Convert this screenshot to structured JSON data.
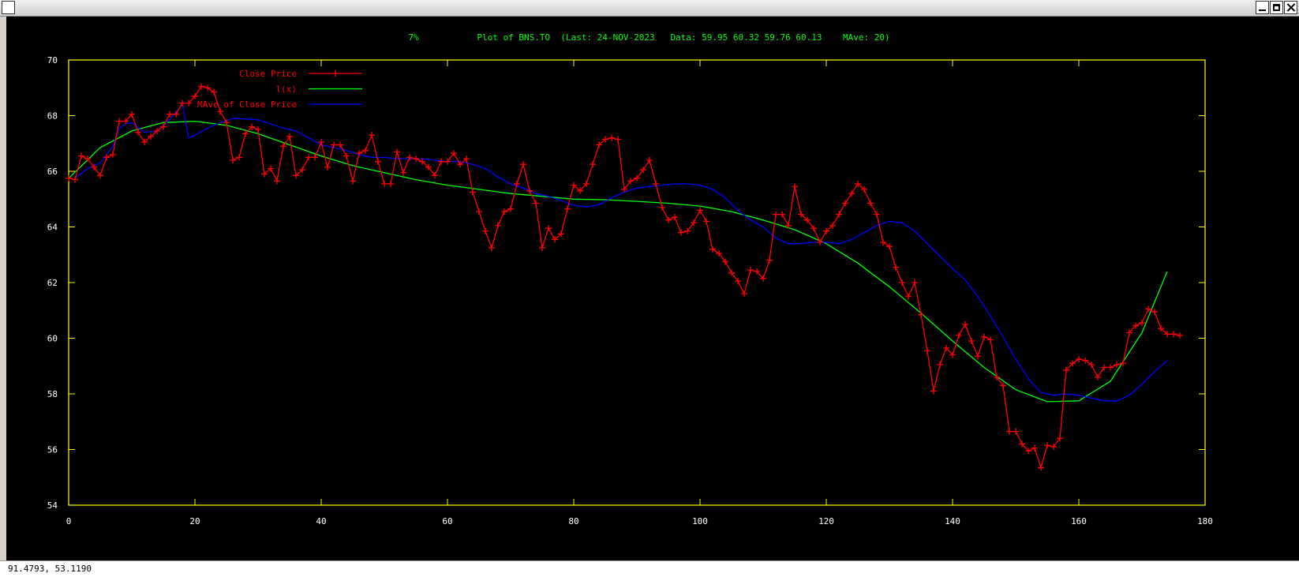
{
  "window": {
    "status_coords": "91.4793,  53.1190"
  },
  "chart_data": {
    "type": "line",
    "title_prefix": "7%",
    "title": "Plot of BNS.TO  (Last: 24-NOV-2023   Data: 59.95 60.32 59.76 60.13    MAve: 20)",
    "xlim": [
      0,
      180
    ],
    "ylim": [
      54,
      70
    ],
    "x_ticks": [
      0,
      20,
      40,
      60,
      80,
      100,
      120,
      140,
      160,
      180
    ],
    "y_ticks": [
      54,
      56,
      58,
      60,
      62,
      64,
      66,
      68,
      70
    ],
    "legend_position": "top-left",
    "colors": {
      "background": "#000000",
      "axes": "#ffff00",
      "title": "#00ff00",
      "close": "#ff0000",
      "fit": "#00ff00",
      "mave": "#0000ff"
    },
    "series": [
      {
        "name": "Close Price",
        "style": "linespoints",
        "values": [
          65.75,
          65.7,
          66.55,
          66.45,
          66.15,
          65.85,
          66.5,
          66.6,
          67.8,
          67.8,
          68.05,
          67.4,
          67.05,
          67.25,
          67.45,
          67.6,
          68.05,
          68.05,
          68.45,
          68.45,
          68.7,
          69.05,
          69.0,
          68.85,
          68.15,
          67.75,
          66.4,
          66.5,
          67.35,
          67.6,
          67.5,
          65.9,
          66.1,
          65.65,
          66.9,
          67.25,
          65.85,
          66.05,
          66.5,
          66.5,
          67.05,
          66.15,
          66.95,
          66.95,
          66.55,
          65.65,
          66.65,
          66.75,
          67.3,
          66.35,
          65.55,
          65.55,
          66.7,
          65.95,
          66.5,
          66.45,
          66.35,
          66.15,
          65.85,
          66.35,
          66.35,
          66.65,
          66.25,
          66.45,
          65.25,
          64.55,
          63.85,
          63.25,
          64.05,
          64.55,
          64.65,
          65.55,
          66.25,
          65.3,
          64.85,
          63.25,
          63.95,
          63.55,
          63.75,
          64.65,
          65.5,
          65.3,
          65.55,
          66.25,
          66.95,
          67.15,
          67.2,
          67.15,
          65.35,
          65.65,
          65.75,
          66.05,
          66.4,
          65.55,
          64.7,
          64.25,
          64.35,
          63.8,
          63.85,
          64.15,
          64.6,
          64.2,
          63.2,
          63.05,
          62.75,
          62.35,
          62.05,
          61.6,
          62.45,
          62.4,
          62.15,
          62.8,
          64.45,
          64.45,
          64.05,
          65.45,
          64.45,
          64.25,
          63.95,
          63.45,
          63.85,
          64.05,
          64.45,
          64.85,
          65.2,
          65.55,
          65.35,
          64.85,
          64.45,
          63.45,
          63.3,
          62.55,
          62.0,
          61.5,
          62.0,
          60.85,
          59.55,
          58.1,
          59.05,
          59.65,
          59.4,
          60.1,
          60.5,
          59.9,
          59.35,
          60.05,
          59.95,
          58.6,
          58.3,
          56.65,
          56.65,
          56.2,
          55.95,
          56.05,
          55.35,
          56.15,
          56.1,
          56.4,
          58.85,
          59.1,
          59.25,
          59.2,
          59.05,
          58.6,
          58.95,
          58.95,
          59.05,
          59.1,
          60.2,
          60.45,
          60.55,
          61.05,
          60.95,
          60.35,
          60.15,
          60.15,
          60.1
        ]
      },
      {
        "name": "l(x)",
        "style": "lines",
        "x": [
          0,
          5,
          10,
          15,
          20,
          25,
          30,
          35,
          40,
          45,
          50,
          55,
          60,
          65,
          70,
          75,
          80,
          85,
          90,
          95,
          100,
          105,
          110,
          115,
          120,
          125,
          130,
          135,
          140,
          145,
          150,
          155,
          160,
          165,
          170,
          174
        ],
        "values": [
          65.75,
          66.85,
          67.45,
          67.75,
          67.8,
          67.65,
          67.35,
          66.95,
          66.55,
          66.2,
          65.95,
          65.7,
          65.5,
          65.35,
          65.2,
          65.1,
          65.0,
          64.98,
          64.92,
          64.85,
          64.75,
          64.55,
          64.25,
          63.9,
          63.4,
          62.7,
          61.85,
          60.9,
          59.9,
          58.95,
          58.15,
          57.72,
          57.75,
          58.45,
          60.2,
          62.4
        ]
      },
      {
        "name": "MAve of Close Price",
        "style": "lines",
        "x": [
          1,
          3,
          5,
          7,
          8,
          9,
          10,
          12,
          14,
          16,
          18,
          19,
          20,
          22,
          24,
          26,
          28,
          30,
          32,
          34,
          36,
          38,
          40,
          42,
          44,
          46,
          48,
          50,
          52,
          54,
          56,
          58,
          60,
          62,
          63,
          64,
          66,
          68,
          70,
          72,
          74,
          76,
          78,
          80,
          82,
          84,
          86,
          88,
          90,
          92,
          94,
          96,
          98,
          100,
          102,
          104,
          106,
          108,
          110,
          112,
          114,
          116,
          118,
          120,
          122,
          124,
          126,
          128,
          130,
          132,
          134,
          136,
          138,
          140,
          142,
          144,
          146,
          148,
          150,
          152,
          154,
          156,
          158,
          160,
          162,
          164,
          166,
          168,
          170,
          172,
          174
        ],
        "values": [
          65.75,
          66.1,
          66.3,
          66.9,
          67.55,
          67.7,
          67.75,
          67.4,
          67.45,
          67.85,
          68.4,
          67.2,
          67.3,
          67.55,
          67.75,
          67.9,
          67.88,
          67.85,
          67.7,
          67.55,
          67.45,
          67.2,
          66.95,
          66.85,
          66.75,
          66.6,
          66.5,
          66.5,
          66.45,
          66.45,
          66.45,
          66.4,
          66.35,
          66.35,
          66.3,
          66.25,
          66.1,
          65.8,
          65.55,
          65.4,
          65.2,
          65.1,
          64.95,
          64.78,
          64.72,
          64.8,
          65.05,
          65.25,
          65.4,
          65.45,
          65.5,
          65.55,
          65.55,
          65.5,
          65.35,
          65.05,
          64.6,
          64.25,
          64.0,
          63.6,
          63.4,
          63.4,
          63.45,
          63.45,
          63.4,
          63.55,
          63.8,
          64.05,
          64.2,
          64.15,
          63.85,
          63.4,
          62.95,
          62.5,
          62.1,
          61.5,
          60.8,
          60.05,
          59.25,
          58.55,
          58.05,
          57.95,
          58.0,
          57.95,
          57.85,
          57.75,
          57.75,
          57.95,
          58.35,
          58.8,
          59.2
        ]
      }
    ]
  }
}
